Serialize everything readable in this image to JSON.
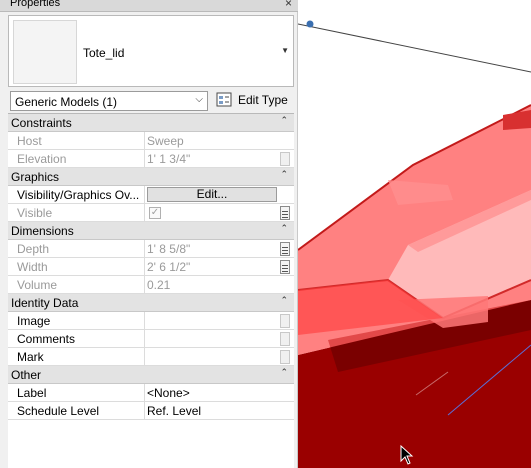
{
  "palette": {
    "title": "Properties",
    "close_glyph": "×"
  },
  "type_selector": {
    "name": "Tote_lid",
    "dropdown_glyph": "▼"
  },
  "instance_filter": {
    "label": "Generic Models (1)",
    "chevron_glyph": "⌵"
  },
  "edit_type": {
    "label": "Edit Type"
  },
  "groups": {
    "constraints": {
      "label": "Constraints",
      "caret": "⌃"
    },
    "graphics": {
      "label": "Graphics",
      "caret": "⌃"
    },
    "dimensions": {
      "label": "Dimensions",
      "caret": "⌃"
    },
    "identity": {
      "label": "Identity Data",
      "caret": "⌃"
    },
    "other": {
      "label": "Other",
      "caret": "⌃"
    }
  },
  "params": {
    "host": {
      "name": "Host",
      "value": "Sweep"
    },
    "elevation": {
      "name": "Elevation",
      "value": "1'  1 3/4\""
    },
    "visibility": {
      "name": "Visibility/Graphics Ov...",
      "button": "Edit..."
    },
    "visible": {
      "name": "Visible",
      "check": "✓"
    },
    "depth": {
      "name": "Depth",
      "value": "1'  8 5/8\""
    },
    "width": {
      "name": "Width",
      "value": "2'  6 1/2\""
    },
    "volume": {
      "name": "Volume",
      "value": "0.21"
    },
    "image": {
      "name": "Image",
      "value": ""
    },
    "comments": {
      "name": "Comments",
      "value": ""
    },
    "mark": {
      "name": "Mark",
      "value": ""
    },
    "label": {
      "name": "Label",
      "value": "<None>"
    },
    "schedule_level": {
      "name": "Schedule Level",
      "value": "Ref. Level"
    }
  },
  "colors": {
    "lid_red": "#ff4a4a",
    "lid_dark": "#a80000",
    "group_bg": "#e3e3e3"
  }
}
